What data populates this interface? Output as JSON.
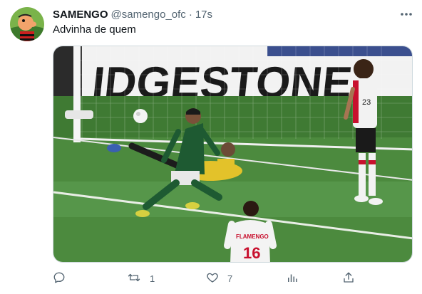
{
  "tweet": {
    "display_name": "SAMENGO",
    "handle": "@samengo_ofc",
    "separator": "·",
    "time": "17s",
    "text": "Advinha de quem",
    "media": {
      "banner_text": "IDGESTONE",
      "player_jersey": "FLAMENGO",
      "player_number": "16",
      "kit_number_far": "23"
    },
    "actions": {
      "reply_count": "",
      "retweet_count": "1",
      "like_count": "7"
    }
  },
  "colors": {
    "text_primary": "#0f1419",
    "text_secondary": "#536471",
    "pitch": "#4c8a3e",
    "palmeiras_green": "#1e5a32",
    "keeper_yellow": "#e3c22a",
    "flamengo_red": "#c8102e"
  },
  "icons": [
    "avatar-cartoon",
    "more-icon",
    "reply-icon",
    "retweet-icon",
    "like-icon",
    "views-icon",
    "share-icon"
  ]
}
